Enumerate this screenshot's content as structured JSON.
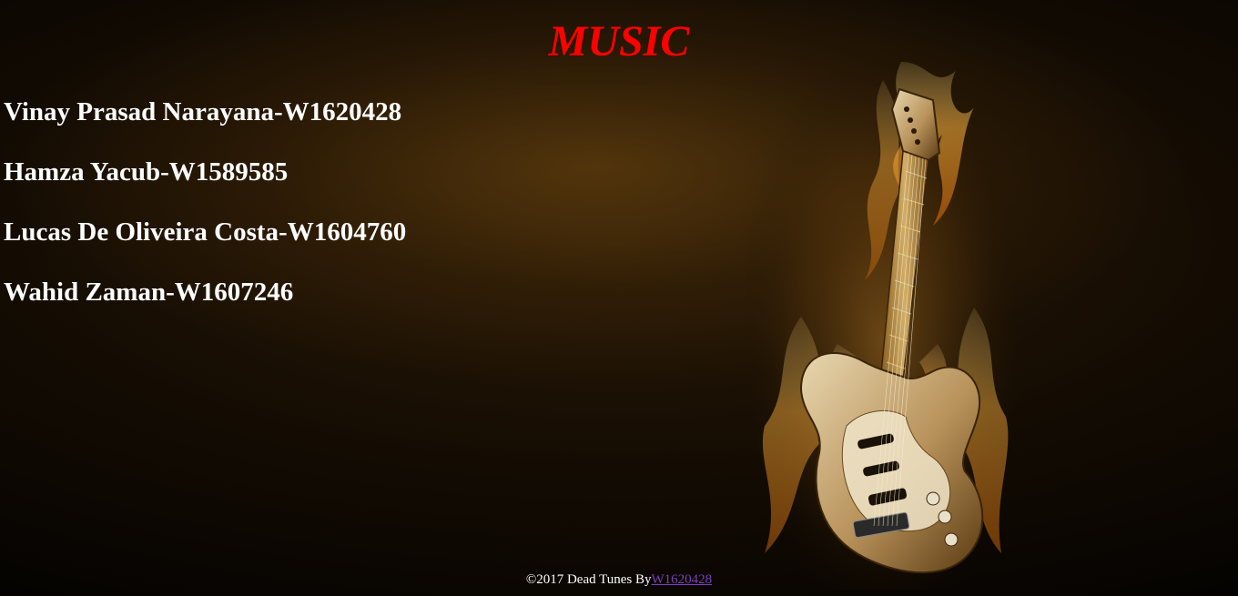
{
  "page": {
    "title": "MUSIC"
  },
  "members": [
    "Vinay Prasad Narayana-W1620428",
    "Hamza Yacub-W1589585",
    "Lucas De Oliveira Costa-W1604760",
    "Wahid Zaman-W1607246"
  ],
  "footer": {
    "text": "©2017 Dead Tunes By",
    "link_text": "W1620428"
  },
  "colors": {
    "title": "#ff0000",
    "text": "#ffffff",
    "link": "#7b3fbf",
    "background": "#140c03"
  },
  "images": {
    "background_art": "flaming-electric-guitar"
  }
}
